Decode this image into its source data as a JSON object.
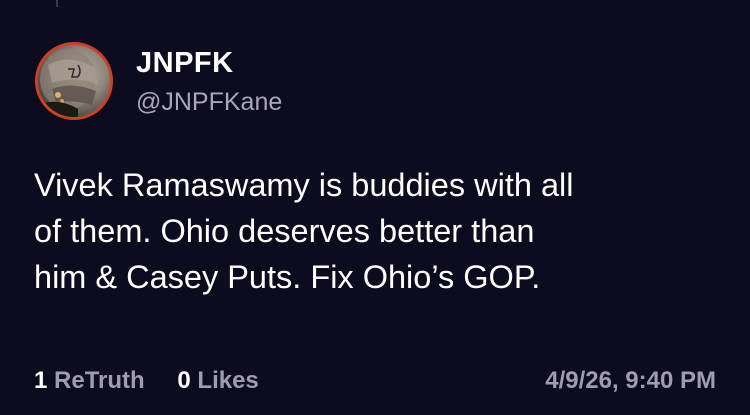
{
  "post": {
    "display_name": "JNPFK",
    "handle": "@JNPFKane",
    "text_lines": [
      "Vivek Ramaswamy is buddies with all",
      "of them. Ohio deserves better than",
      "him & Casey Puts. Fix Ohio’s GOP."
    ],
    "retruths_count": "1",
    "retruths_label": "ReTruth",
    "likes_count": "0",
    "likes_label": "Likes",
    "timestamp": "4/9/26, 9:40 PM"
  },
  "colors": {
    "background": "#0d0b1e",
    "text": "#ffffff",
    "muted": "#9e9cae",
    "avatar_ring": "#c8422b"
  },
  "icons": {
    "avatar": "profile-photo-avatar"
  }
}
